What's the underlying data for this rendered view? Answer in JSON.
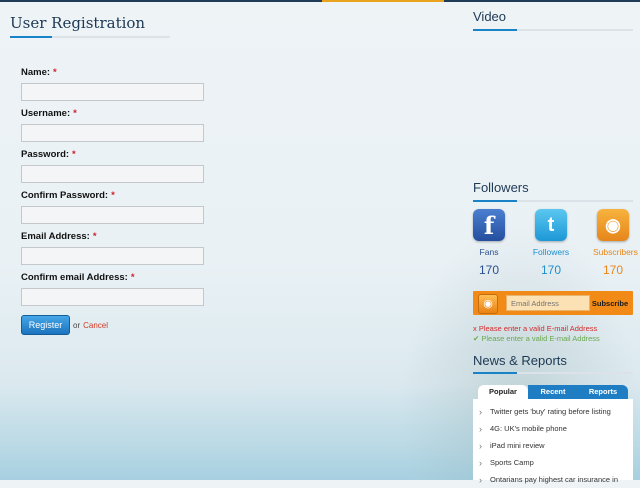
{
  "registration": {
    "title": "User Registration",
    "fields": [
      {
        "label": "Name:",
        "required": "*",
        "value": ""
      },
      {
        "label": "Username:",
        "required": "*",
        "value": ""
      },
      {
        "label": "Password:",
        "required": "*",
        "value": ""
      },
      {
        "label": "Confirm Password:",
        "required": "*",
        "value": ""
      },
      {
        "label": "Email Address:",
        "required": "*",
        "value": ""
      },
      {
        "label": "Confirm email Address:",
        "required": "*",
        "value": ""
      }
    ],
    "register_label": "Register",
    "or_text": "or",
    "cancel_label": "Cancel"
  },
  "video": {
    "title": "Video"
  },
  "followers": {
    "title": "Followers",
    "items": [
      {
        "icon": "facebook-icon",
        "glyph": "f",
        "label": "Fans",
        "count": "170"
      },
      {
        "icon": "twitter-icon",
        "glyph": "t",
        "label": "Followers",
        "count": "170"
      },
      {
        "icon": "rss-icon",
        "glyph": "◉",
        "label": "Subscribers",
        "count": "170"
      }
    ]
  },
  "subscribe": {
    "placeholder": "Email Address",
    "button_label": "Subscribe",
    "error_prefix": "x",
    "error_message": "Please enter a valid E-mail Address",
    "success_prefix": "✔",
    "success_message": "Please enter a valid E-mail Address"
  },
  "news": {
    "title": "News & Reports",
    "tabs": [
      "Popular",
      "Recent",
      "Reports"
    ],
    "active_tab": "Popular",
    "items": [
      "Twitter gets 'buy' rating before listing",
      "4G: UK's mobile phone",
      "iPad mini review",
      "Sports Camp",
      "Ontarians pay highest car insurance in"
    ]
  },
  "colors": {
    "accent_blue": "#1a83c8",
    "title_navy": "#1d3954",
    "required_red": "#d0202a",
    "subscribe_orange": "#f28a18"
  }
}
